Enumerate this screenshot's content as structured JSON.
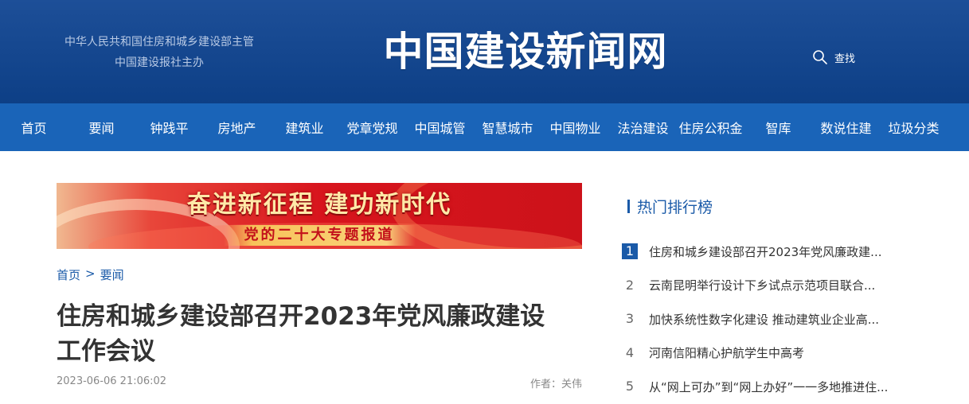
{
  "header": {
    "sponsor_line1": "中华人民共和国住房和城乡建设部主管",
    "sponsor_line2": "中国建设报社主办",
    "site_title": "中国建设新闻网",
    "search_label": "查找"
  },
  "nav": {
    "items": [
      {
        "label": "首页"
      },
      {
        "label": "要闻"
      },
      {
        "label": "钟践平"
      },
      {
        "label": "房地产"
      },
      {
        "label": "建筑业"
      },
      {
        "label": "党章党规"
      },
      {
        "label": "中国城管"
      },
      {
        "label": "智慧城市"
      },
      {
        "label": "中国物业"
      },
      {
        "label": "法治建设"
      },
      {
        "label": "住房公积金"
      },
      {
        "label": "智库"
      },
      {
        "label": "数说住建"
      },
      {
        "label": "垃圾分类"
      }
    ]
  },
  "banner": {
    "main": "奋进新征程 建功新时代",
    "sub": "党的二十大专题报道"
  },
  "breadcrumb": {
    "home": "首页",
    "separator": ">",
    "section": "要闻"
  },
  "article": {
    "title_line1": "住房和城乡建设部召开2023年党风廉政建设",
    "title_line2": "工作会议",
    "datetime": "2023-06-06 21:06:02",
    "author": "作者：关伟"
  },
  "sidebar": {
    "title": "热门排行榜",
    "items": [
      {
        "rank": "1",
        "text": "住房和城乡建设部召开2023年党风廉政建..."
      },
      {
        "rank": "2",
        "text": "云南昆明举行设计下乡试点示范项目联合..."
      },
      {
        "rank": "3",
        "text": "加快系统性数字化建设 推动建筑业企业高..."
      },
      {
        "rank": "4",
        "text": "河南信阳精心护航学生中高考"
      },
      {
        "rank": "5",
        "text": "从“网上可办”到“网上办好”一一多地推进住..."
      }
    ]
  },
  "colors": {
    "header_bg": "#134a92",
    "nav_bg": "#1a64b8",
    "accent": "#1a5aa8",
    "banner_red": "#d8151d"
  }
}
